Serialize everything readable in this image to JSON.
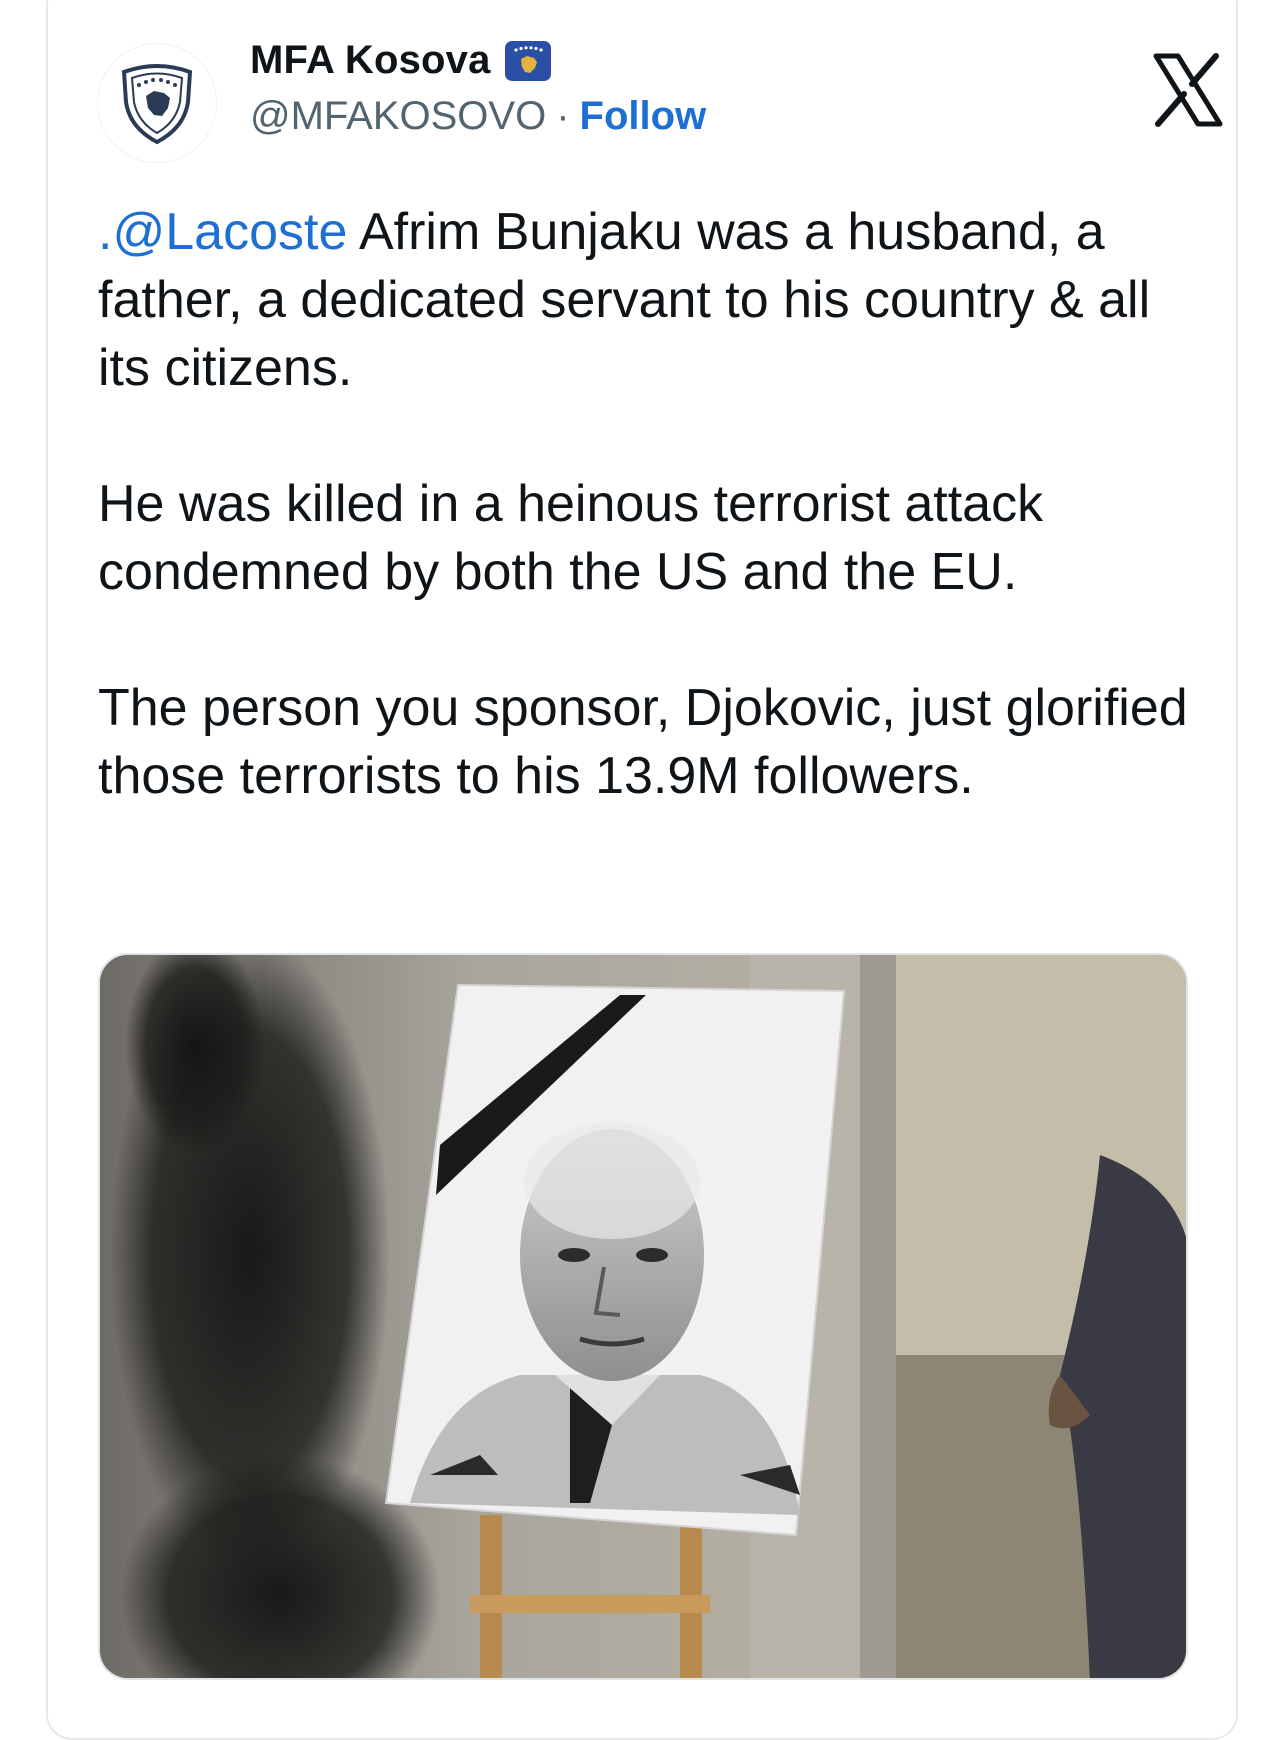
{
  "post": {
    "display_name": "MFA Kosova",
    "verified_badge_icon": "kosovo-flag-icon",
    "handle": "@MFAKOSOVO",
    "separator": "·",
    "follow_label": "Follow",
    "platform_icon": "x-logo-icon",
    "avatar_icon": "kosovo-coat-of-arms-icon",
    "text": {
      "mention": ".@Lacoste",
      "paragraph_1_rest": " Afrim Bunjaku was a husband, a father, a dedicated servant to his country & all its citizens.",
      "paragraph_2": "He was killed in a heinous terrorist attack condemned by both the US and the EU.",
      "paragraph_3": "The person you sponsor, Djokovic, just glorified those terrorists to his 13.9M followers."
    },
    "media": {
      "type": "photo",
      "subject": "memorial-portrait-photo"
    }
  },
  "colors": {
    "link": "#1d6fd3",
    "text": "#0f1419",
    "secondary_text": "#536471",
    "border": "#e6e8ea"
  }
}
